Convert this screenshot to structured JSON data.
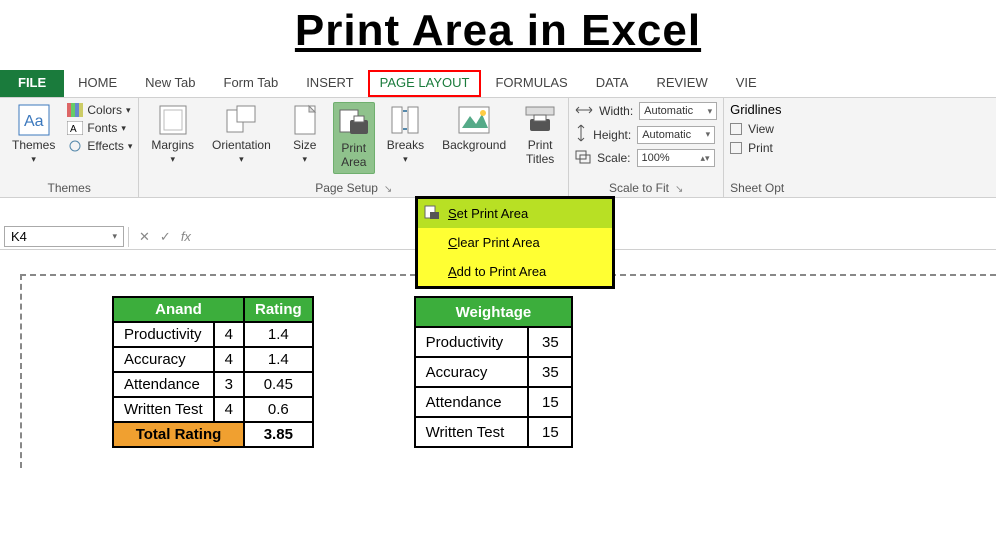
{
  "title": "Print Area in Excel",
  "tabs": [
    "FILE",
    "HOME",
    "New Tab",
    "Form Tab",
    "INSERT",
    "PAGE LAYOUT",
    "FORMULAS",
    "DATA",
    "REVIEW",
    "VIE"
  ],
  "active_tab": "PAGE LAYOUT",
  "ribbon": {
    "themes": {
      "label": "Themes",
      "btn": "Themes",
      "colors": "Colors",
      "fonts": "Fonts",
      "effects": "Effects"
    },
    "page_setup": {
      "label": "Page Setup",
      "margins": "Margins",
      "orientation": "Orientation",
      "size": "Size",
      "print_area": "Print\nArea",
      "breaks": "Breaks",
      "background": "Background",
      "print_titles": "Print\nTitles"
    },
    "scale": {
      "label": "Scale to Fit",
      "width_lbl": "Width:",
      "height_lbl": "Height:",
      "scale_lbl": "Scale:",
      "width": "Automatic",
      "height": "Automatic",
      "scale": "100%"
    },
    "sheet_opt": {
      "label": "Sheet Opt",
      "grid": "Gridlines",
      "view": "View",
      "print": "Print"
    }
  },
  "dropdown": {
    "set": "Set Print Area",
    "clear": "Clear Print Area",
    "add": "Add to Print Area"
  },
  "formula": {
    "name": "K4",
    "fx_label": "fx"
  },
  "table1": {
    "headers": [
      "Anand",
      "Rating"
    ],
    "rows": [
      {
        "label": "Productivity",
        "v1": "4",
        "v2": "1.4"
      },
      {
        "label": "Accuracy",
        "v1": "4",
        "v2": "1.4"
      },
      {
        "label": "Attendance",
        "v1": "3",
        "v2": "0.45"
      },
      {
        "label": "Written Test",
        "v1": "4",
        "v2": "0.6"
      }
    ],
    "total_label": "Total Rating",
    "total": "3.85"
  },
  "table2": {
    "header": "Weightage",
    "rows": [
      {
        "label": "Productivity",
        "v": "35"
      },
      {
        "label": "Accuracy",
        "v": "35"
      },
      {
        "label": "Attendance",
        "v": "15"
      },
      {
        "label": "Written Test",
        "v": "15"
      }
    ]
  }
}
